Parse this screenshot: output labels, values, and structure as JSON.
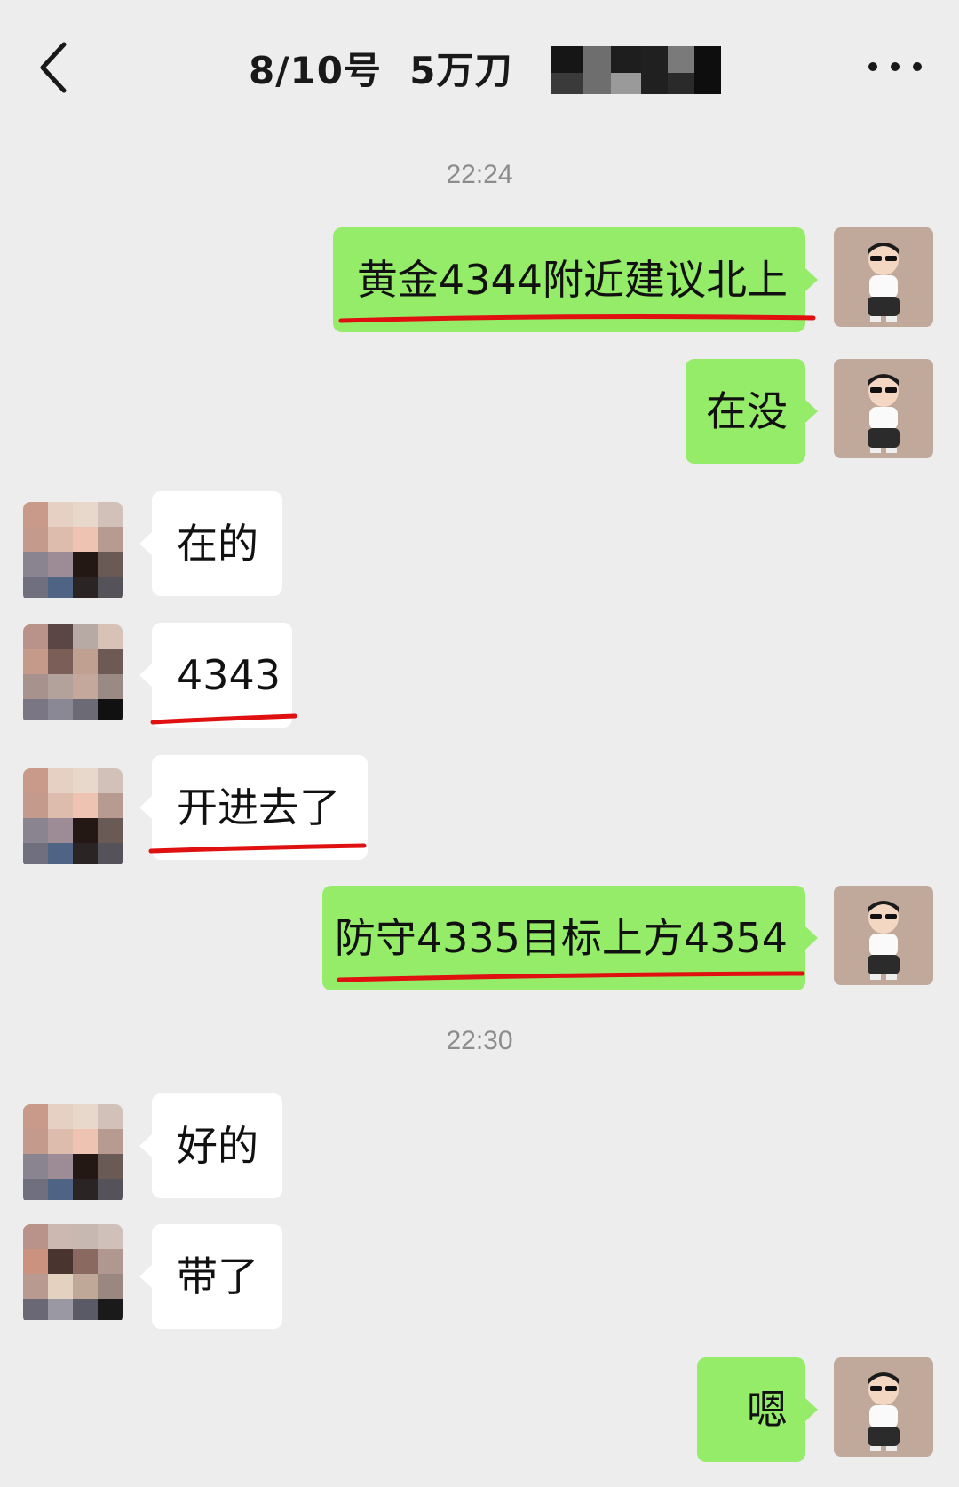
{
  "header": {
    "title": "8/10号  5万刀",
    "back_icon": "chevron-left-icon",
    "more_icon": "more-dots-icon"
  },
  "messages": [
    {
      "type": "time",
      "text": "22:24"
    },
    {
      "type": "out",
      "text": "黄金4344附近建议北上",
      "underlined": true
    },
    {
      "type": "out",
      "text": "在没"
    },
    {
      "type": "in",
      "text": "在的"
    },
    {
      "type": "in",
      "text": "4343",
      "underlined": true
    },
    {
      "type": "in",
      "text": "开进去了",
      "underlined": true
    },
    {
      "type": "out",
      "text": "防守4335目标上方4354",
      "underlined": true
    },
    {
      "type": "time",
      "text": "22:30"
    },
    {
      "type": "in",
      "text": "好的"
    },
    {
      "type": "in",
      "text": "带了"
    },
    {
      "type": "out",
      "text": "嗯"
    }
  ],
  "colors": {
    "background": "#ededed",
    "outgoing_bubble": "#95ec69",
    "incoming_bubble": "#ffffff",
    "underline": "#e01010"
  }
}
